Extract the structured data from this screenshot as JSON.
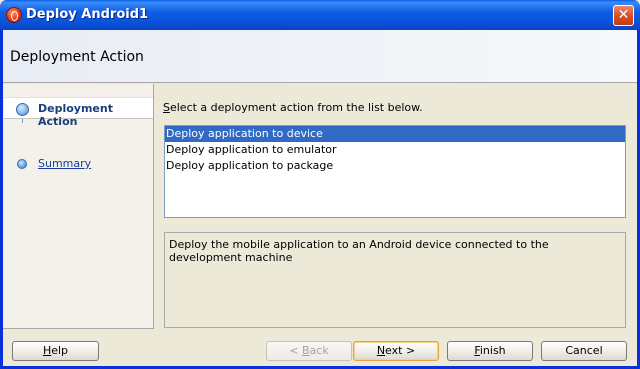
{
  "window": {
    "title": "Deploy Android1",
    "close_symbol": "✕"
  },
  "header": {
    "title": "Deployment Action"
  },
  "steps": [
    {
      "label": "Deployment Action",
      "active": true
    },
    {
      "label": "Summary",
      "active": false
    }
  ],
  "main": {
    "instruction_key": "S",
    "instruction_rest": "elect a deployment action from the list below.",
    "actions": [
      "Deploy application to device",
      "Deploy application to emulator",
      "Deploy application to package"
    ],
    "selected_index": 0,
    "description": "Deploy the mobile application to an Android device connected to the development machine"
  },
  "buttons": {
    "help": {
      "key": "H",
      "rest": "elp"
    },
    "back": {
      "prefix": "< ",
      "key": "B",
      "rest": "ack"
    },
    "next": {
      "key": "N",
      "rest": "ext >"
    },
    "finish": {
      "key": "F",
      "rest": "inish"
    },
    "cancel": "Cancel"
  },
  "colors": {
    "selection": "#316ac5",
    "titlebar": "#0a55dd",
    "default_button_border": "#e8a03a"
  }
}
